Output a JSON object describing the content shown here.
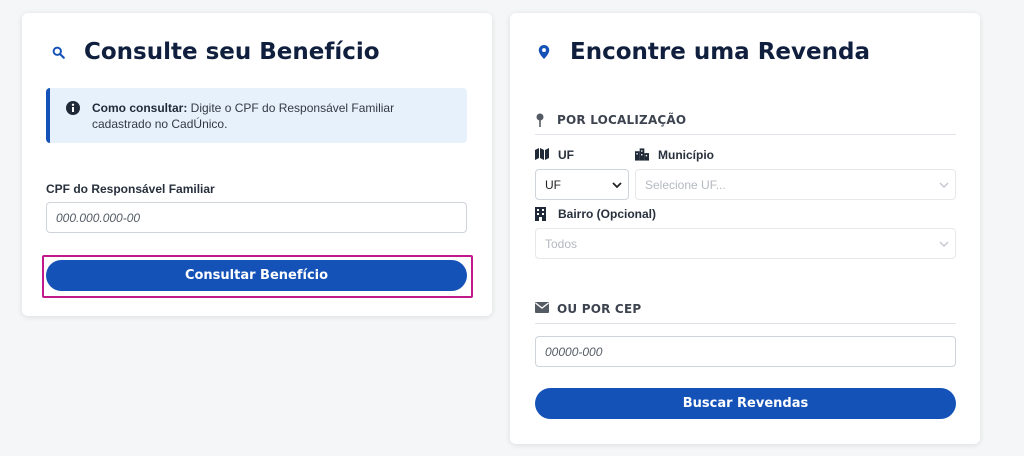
{
  "left_card": {
    "title": "Consulte seu Benefício",
    "info": {
      "bold": "Como consultar:",
      "text": " Digite o CPF do Responsável Familiar cadastrado no CadÚnico."
    },
    "cpf_label": "CPF do Responsável Familiar",
    "cpf_placeholder": "000.000.000-00",
    "submit_label": "Consultar Benefício"
  },
  "right_card": {
    "title": "Encontre uma Revenda",
    "location_section": "POR LOCALIZAÇÃO",
    "uf_label": "UF",
    "uf_value": "UF",
    "municipio_label": "Município",
    "municipio_value": "Selecione UF...",
    "bairro_label": "Bairro (Opcional)",
    "bairro_value": "Todos",
    "cep_section": "OU POR CEP",
    "cep_placeholder": "00000-000",
    "search_label": "Buscar Revendas"
  },
  "colors": {
    "primary": "#1552b8",
    "highlight": "#c2198a",
    "info_bg": "#e7f1fc"
  }
}
